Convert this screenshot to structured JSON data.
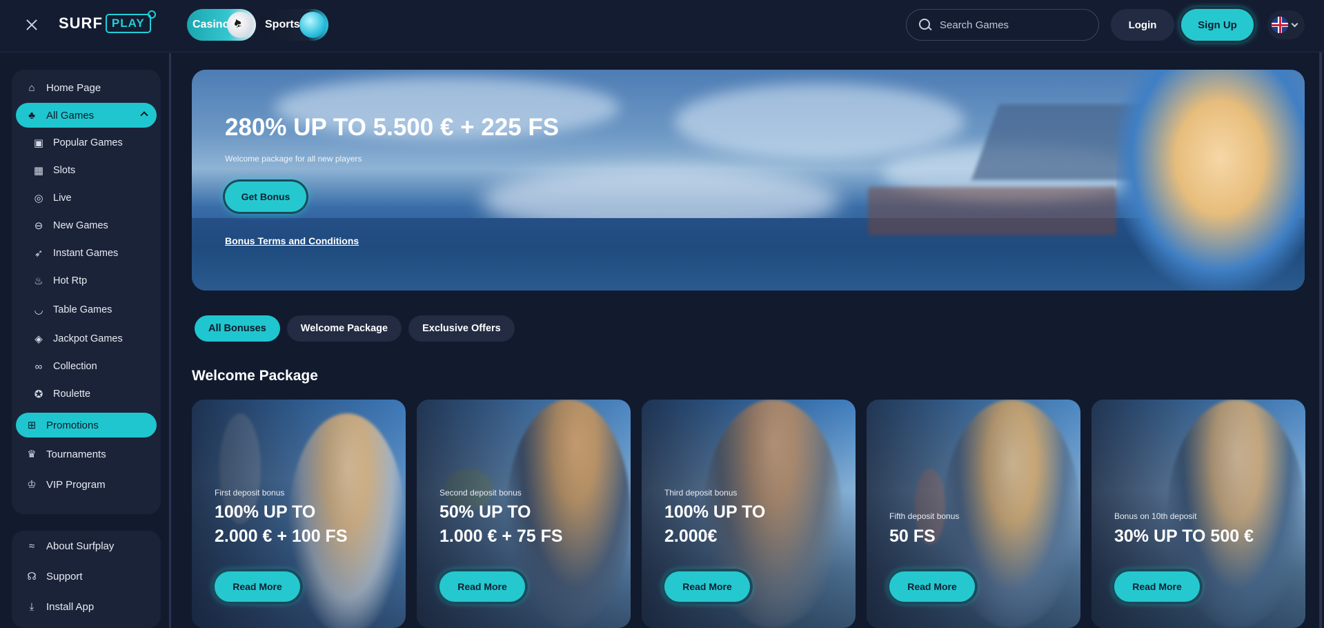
{
  "header": {
    "logo_primary": "SURF",
    "logo_secondary": "PLAY",
    "tabs": [
      {
        "label": "Casino"
      },
      {
        "label": "Sports"
      }
    ],
    "search_placeholder": "Search Games",
    "login_label": "Login",
    "signup_label": "Sign Up",
    "language_flag": "uk-flag-icon"
  },
  "sidebar": {
    "items": [
      {
        "label": "Home Page",
        "icon": "home-icon"
      },
      {
        "label": "All Games",
        "icon": "games-icon"
      },
      {
        "label": "Popular Games",
        "icon": "popular-icon"
      },
      {
        "label": "Slots",
        "icon": "slots-icon"
      },
      {
        "label": "Live",
        "icon": "live-icon"
      },
      {
        "label": "New Games",
        "icon": "new-icon"
      },
      {
        "label": "Instant Games",
        "icon": "rocket-icon"
      },
      {
        "label": "Hot Rtp",
        "icon": "flame-icon"
      },
      {
        "label": "Table Games",
        "icon": "table-icon"
      },
      {
        "label": "Jackpot Games",
        "icon": "diamond-icon"
      },
      {
        "label": "Collection",
        "icon": "link-icon"
      },
      {
        "label": "Roulette",
        "icon": "roulette-icon"
      },
      {
        "label": "Promotions",
        "icon": "gift-icon"
      },
      {
        "label": "Tournaments",
        "icon": "trophy-icon"
      },
      {
        "label": "VIP Program",
        "icon": "crown-icon"
      }
    ],
    "footer_items": [
      {
        "label": "About Surfplay",
        "icon": "wave-icon"
      },
      {
        "label": "Support",
        "icon": "headset-icon"
      },
      {
        "label": "Install App",
        "icon": "download-icon"
      }
    ]
  },
  "hero": {
    "title": "280% UP TO 5.500 € + 225 FS",
    "subtitle": "Welcome package for all new players",
    "button_label": "Get Bonus",
    "terms_link": "Bonus Terms and Conditions"
  },
  "filters": [
    {
      "label": "All Bonuses"
    },
    {
      "label": "Welcome Package"
    },
    {
      "label": "Exclusive Offers"
    }
  ],
  "section_title": "Welcome Package",
  "cards": [
    {
      "label": "First deposit bonus",
      "title_line1": "100% UP TO",
      "title_line2": "2.000 € + 100 FS",
      "button": "Read More"
    },
    {
      "label": "Second deposit bonus",
      "title_line1": "50% UP TO",
      "title_line2": "1.000 € + 75 FS",
      "button": "Read More"
    },
    {
      "label": "Third deposit bonus",
      "title_line1": "100% UP TO",
      "title_line2": "2.000€",
      "button": "Read More"
    },
    {
      "label": "Fifth deposit bonus",
      "title_line1": "50 FS",
      "title_line2": "",
      "button": "Read More"
    },
    {
      "label": "Bonus on 10th deposit",
      "title_line1": "30% UP TO 500 €",
      "title_line2": "",
      "button": "Read More"
    }
  ],
  "colors": {
    "accent": "#1fc6cf",
    "background": "#121a2e",
    "panel": "#1b2338"
  }
}
